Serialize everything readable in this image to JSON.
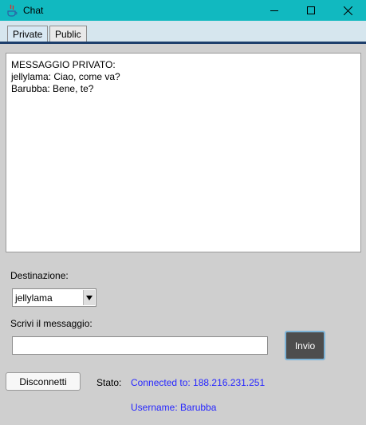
{
  "window": {
    "title": "Chat",
    "controls": [
      "minimize",
      "maximize",
      "close"
    ]
  },
  "tabs": [
    {
      "label": "Private",
      "selected": true
    },
    {
      "label": "Public",
      "selected": false
    }
  ],
  "chat": {
    "lines": [
      "MESSAGGIO PRIVATO:",
      "jellylama: Ciao, come va?",
      "Barubba: Bene, te?"
    ]
  },
  "destination": {
    "label": "Destinazione:",
    "selected": "jellylama"
  },
  "message": {
    "label": "Scrivi il messaggio:",
    "value": "",
    "send_label": "Invio"
  },
  "footer": {
    "disconnect_label": "Disconnetti",
    "status_label": "Stato:",
    "connection": "Connected to: 188.216.231.251",
    "username": "Username: Barubba"
  },
  "colors": {
    "titlebar": "#11b9c0",
    "status_text": "#2727ff",
    "send_button": "#4d4d4d"
  }
}
